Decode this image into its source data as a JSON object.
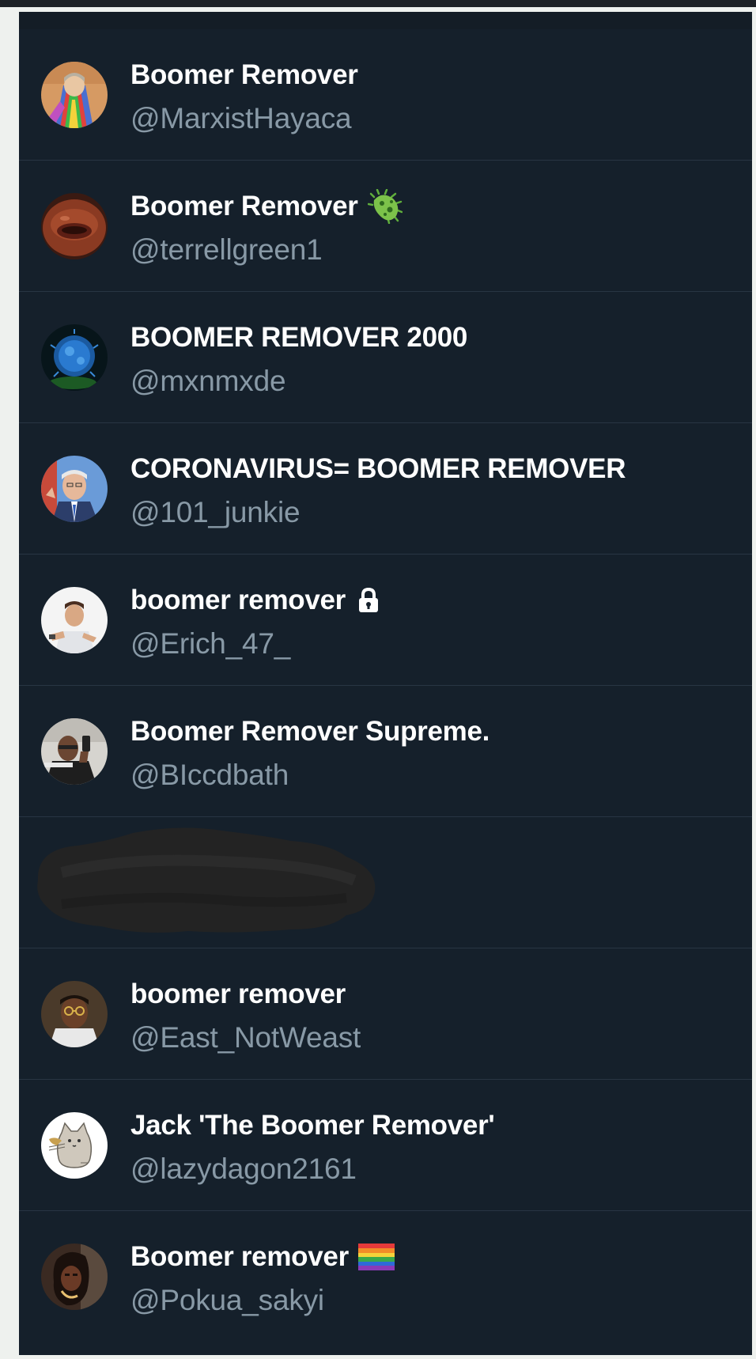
{
  "users": [
    {
      "name": "Boomer Remover",
      "handle": "@MarxistHayaca"
    },
    {
      "name": "Boomer Remover",
      "handle": "@terrellgreen1",
      "badge": "microbe-icon"
    },
    {
      "name": "BOOMER REMOVER 2000",
      "handle": "@mxnmxde"
    },
    {
      "name": "CORONAVIRUS= BOOMER REMOVER",
      "handle": "@101_junkie"
    },
    {
      "name": "boomer remover",
      "handle": "@Erich_47_",
      "badge": "lock-icon"
    },
    {
      "name": "Boomer Remover Supreme.",
      "handle": "@BIccdbath"
    },
    {
      "redacted": true
    },
    {
      "name": "boomer remover",
      "handle": "@East_NotWeast"
    },
    {
      "name": "Jack 'The Boomer Remover'",
      "handle": "@lazydagon2161"
    },
    {
      "name": "Boomer remover",
      "handle": "@Pokua_sakyi",
      "badge": "rainbow-flag-icon"
    }
  ],
  "colors": {
    "background": "#15202b",
    "divider": "#283543",
    "name": "#ffffff",
    "handle": "#8899a6"
  }
}
